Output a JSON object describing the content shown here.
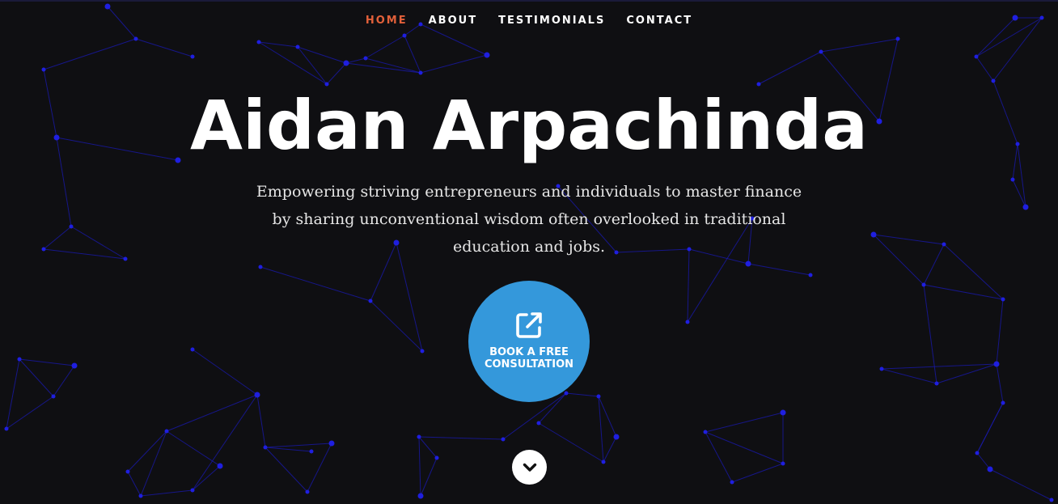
{
  "nav": {
    "items": [
      {
        "label": "HOME",
        "active": true
      },
      {
        "label": "ABOUT",
        "active": false
      },
      {
        "label": "TESTIMONIALS",
        "active": false
      },
      {
        "label": "CONTACT",
        "active": false
      }
    ]
  },
  "hero": {
    "title": "Aidan Arpachinda",
    "tagline": "Empowering striving entrepreneurs and individuals to master finance by sharing unconventional wisdom often overlooked in traditional education and jobs.",
    "cta": {
      "label": "BOOK A FREE\nCONSULTATION",
      "icon": "external-link-icon"
    },
    "scroll_icon": "chevron-down-icon"
  },
  "colors": {
    "background": "#0f0f12",
    "accent_active_nav": "#e2603a",
    "cta_background": "#3498db",
    "network_lines": "#1a1ab0",
    "network_nodes": "#1f1fe0"
  }
}
